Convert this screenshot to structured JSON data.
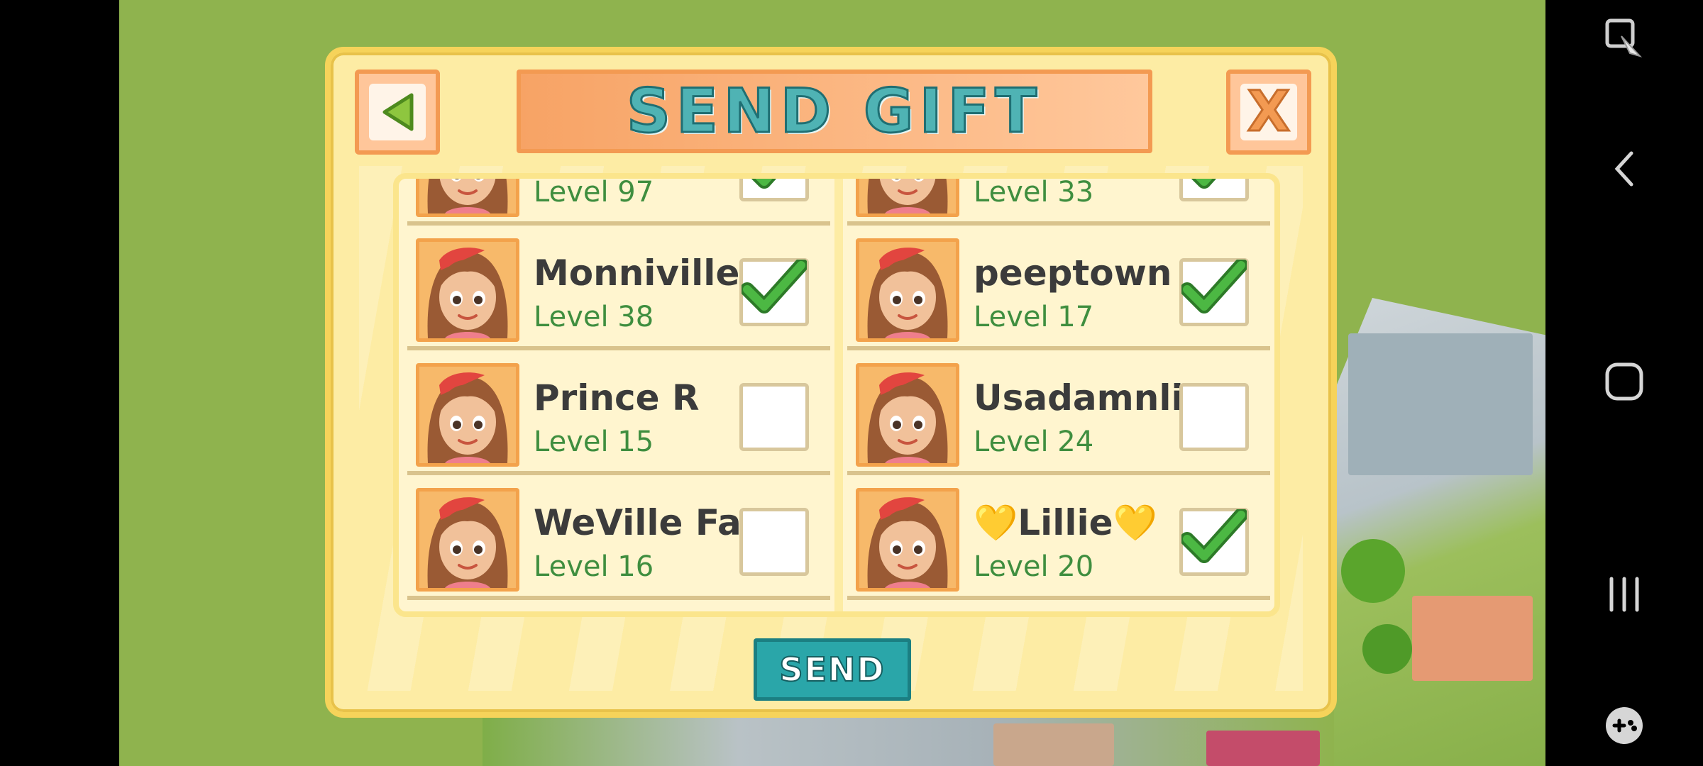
{
  "dialog": {
    "title": "SEND GIFT",
    "back_icon": "back-arrow-icon",
    "close_label": "X",
    "send_label": "SEND"
  },
  "friends_left": [
    {
      "name": "",
      "level": "Level 97",
      "checked": true
    },
    {
      "name": "Monniville",
      "level": "Level 38",
      "checked": true
    },
    {
      "name": "Prince R",
      "level": "Level 15",
      "checked": false
    },
    {
      "name": "WeVille Falls",
      "level": "Level 16",
      "checked": false
    }
  ],
  "friends_right": [
    {
      "name": "",
      "level": "Level 33",
      "checked": true
    },
    {
      "name": "peeptown",
      "level": "Level 17",
      "checked": true
    },
    {
      "name": "Usadamnlie",
      "level": "Level 24",
      "checked": false
    },
    {
      "name": "💛Lillie💛",
      "level": "Level 20",
      "checked": true
    }
  ],
  "nav": {
    "icons": [
      "screenshot-edit-icon",
      "back-icon",
      "home-icon",
      "recents-icon",
      "game-controller-icon"
    ]
  },
  "colors": {
    "dialog_bg": "#fdeca4",
    "title_text": "#4fb3b4",
    "send_button": "#2aa6a9",
    "check_green": "#3fa33a",
    "level_text": "#3f8e3f"
  }
}
